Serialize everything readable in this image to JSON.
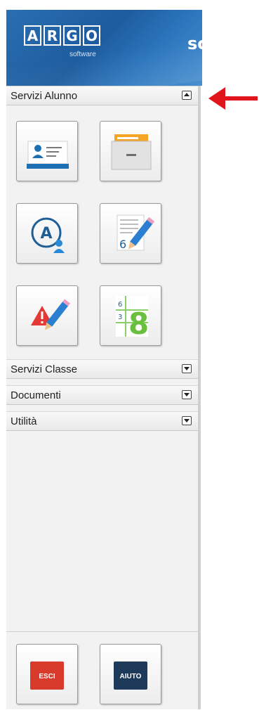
{
  "header": {
    "logo_letters": [
      "A",
      "R",
      "G",
      "O"
    ],
    "logo_sub": "software",
    "banner_text": "sc"
  },
  "sections": [
    {
      "label": "Servizi Alunno",
      "expanded": true
    },
    {
      "label": "Servizi Classe",
      "expanded": false
    },
    {
      "label": "Documenti",
      "expanded": false
    },
    {
      "label": "Utilità",
      "expanded": false
    }
  ],
  "tiles": [
    {
      "icon": "student-card-icon"
    },
    {
      "icon": "file-drawer-icon"
    },
    {
      "icon": "absence-icon"
    },
    {
      "icon": "grades-pencil-icon"
    },
    {
      "icon": "notes-warning-icon"
    },
    {
      "icon": "grade-grid-icon"
    }
  ],
  "footer": {
    "exit_label": "ESCI",
    "help_label": "AIUTO"
  },
  "tile_texts": {
    "grade_six": "6",
    "grid_six": "6",
    "grid_three": "3",
    "grid_eight": "8"
  },
  "colors": {
    "banner": "#1d5c9e",
    "tile_blue": "#1f6fb5",
    "warning_red": "#e53935",
    "grade_green": "#6abf3f",
    "exit_red": "#d83a2c",
    "help_navy": "#1e3a5a",
    "annotation_arrow": "#e0161c"
  }
}
